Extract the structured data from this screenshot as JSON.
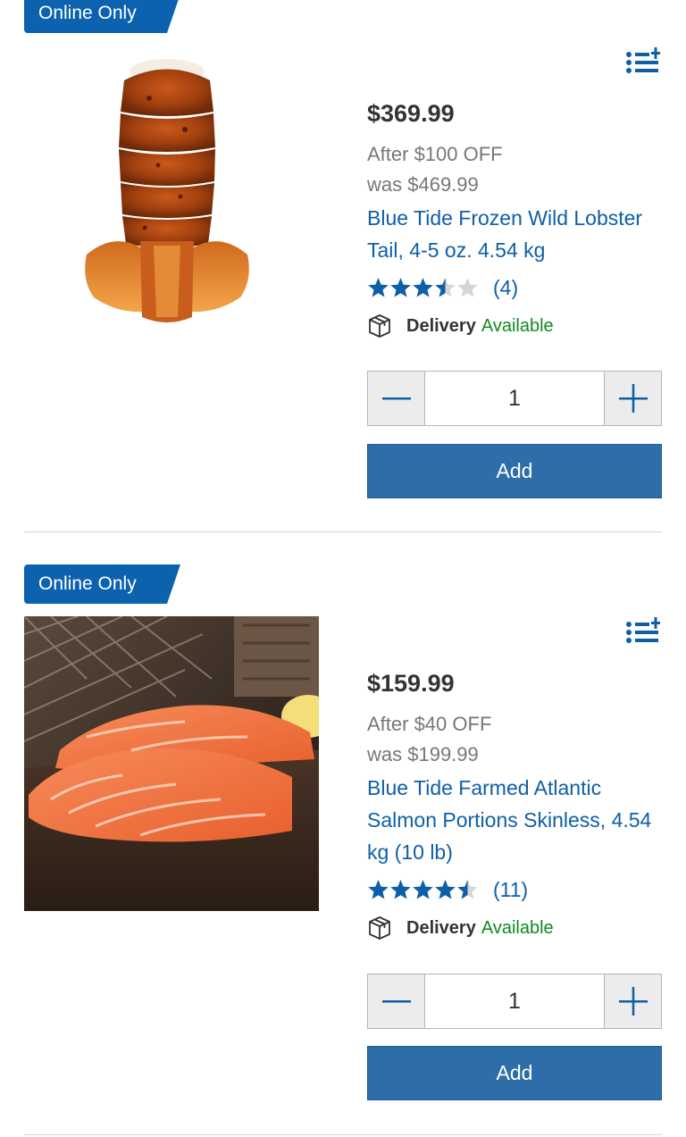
{
  "products": [
    {
      "badge": "Online Only",
      "price": "$369.99",
      "promo": "After $100 OFF",
      "was": "was $469.99",
      "title": "Blue Tide Frozen Wild Lobster Tail, 4-5 oz. 4.54 kg",
      "rating": 3.5,
      "reviews": "(4)",
      "delivery_label": "Delivery",
      "delivery_status": "Available",
      "quantity": "1",
      "add_label": "Add",
      "image": "lobster-tail-image"
    },
    {
      "badge": "Online Only",
      "price": "$159.99",
      "promo": "After $40 OFF",
      "was": "was $199.99",
      "title": "Blue Tide Farmed Atlantic Salmon Portions Skinless, 4.54 kg (10 lb)",
      "rating": 4.5,
      "reviews": "(11)",
      "delivery_label": "Delivery",
      "delivery_status": "Available",
      "quantity": "1",
      "add_label": "Add",
      "image": "salmon-portions-image"
    }
  ],
  "colors": {
    "brand_blue": "#0d62b0",
    "link_blue": "#0e5fa8",
    "button_blue": "#2d6ea8",
    "available_green": "#0f8a1e"
  }
}
